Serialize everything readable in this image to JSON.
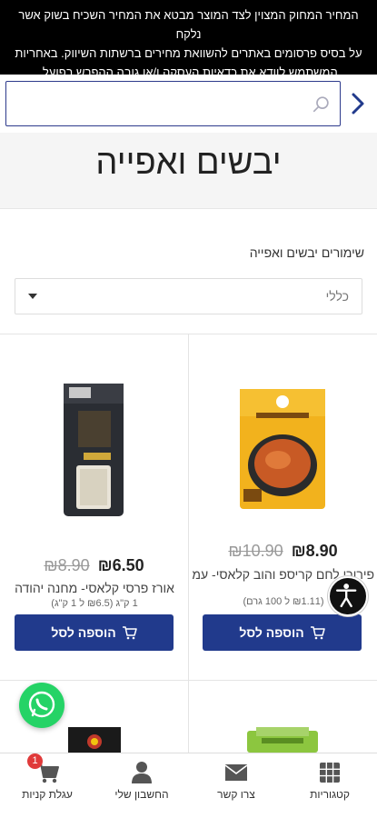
{
  "notice": {
    "line1": "המחיר המחוק המצוין לצד המוצר מבטא את המחיר השכיח בשוק אשר נלקח",
    "line2": "על בסיס פרסומים באתרים להשוואת מחירים ברשתות השיווק. באחריות",
    "line3": "המשתמש לוודא את כדאיות העסקה ו/או גובה ההפרש בפועל."
  },
  "search": {
    "placeholder": "",
    "value": ""
  },
  "page": {
    "title": "יבשים ואפייה"
  },
  "filter": {
    "category_label": "שימורים יבשים ואפייה",
    "selected": "כללי"
  },
  "products": [
    {
      "price": "₪8.90",
      "old_price": "₪10.90",
      "name": "פירורי לחם קריספ והוב קלאסי- עמ'ימון",
      "unit": "(₪1.11 ל 100 גרם)",
      "add_label": "הוספה לסל"
    },
    {
      "price": "₪6.50",
      "old_price": "₪8.90",
      "name": "אורז פרסי קלאסי- מחנה יהודה",
      "unit": "1 ק\"ג (₪6.5 ל 1 ק\"ג)",
      "add_label": "הוספה לסל"
    }
  ],
  "bottom_nav": {
    "categories": "קטגוריות",
    "contact": "צרו קשר",
    "account": "החשבון שלי",
    "cart": "עגלת קניות",
    "cart_count": "1"
  },
  "colors": {
    "accent": "#213a8c",
    "whatsapp": "#25d366",
    "badge": "#e03a3a",
    "notice_bg": "#000000"
  }
}
